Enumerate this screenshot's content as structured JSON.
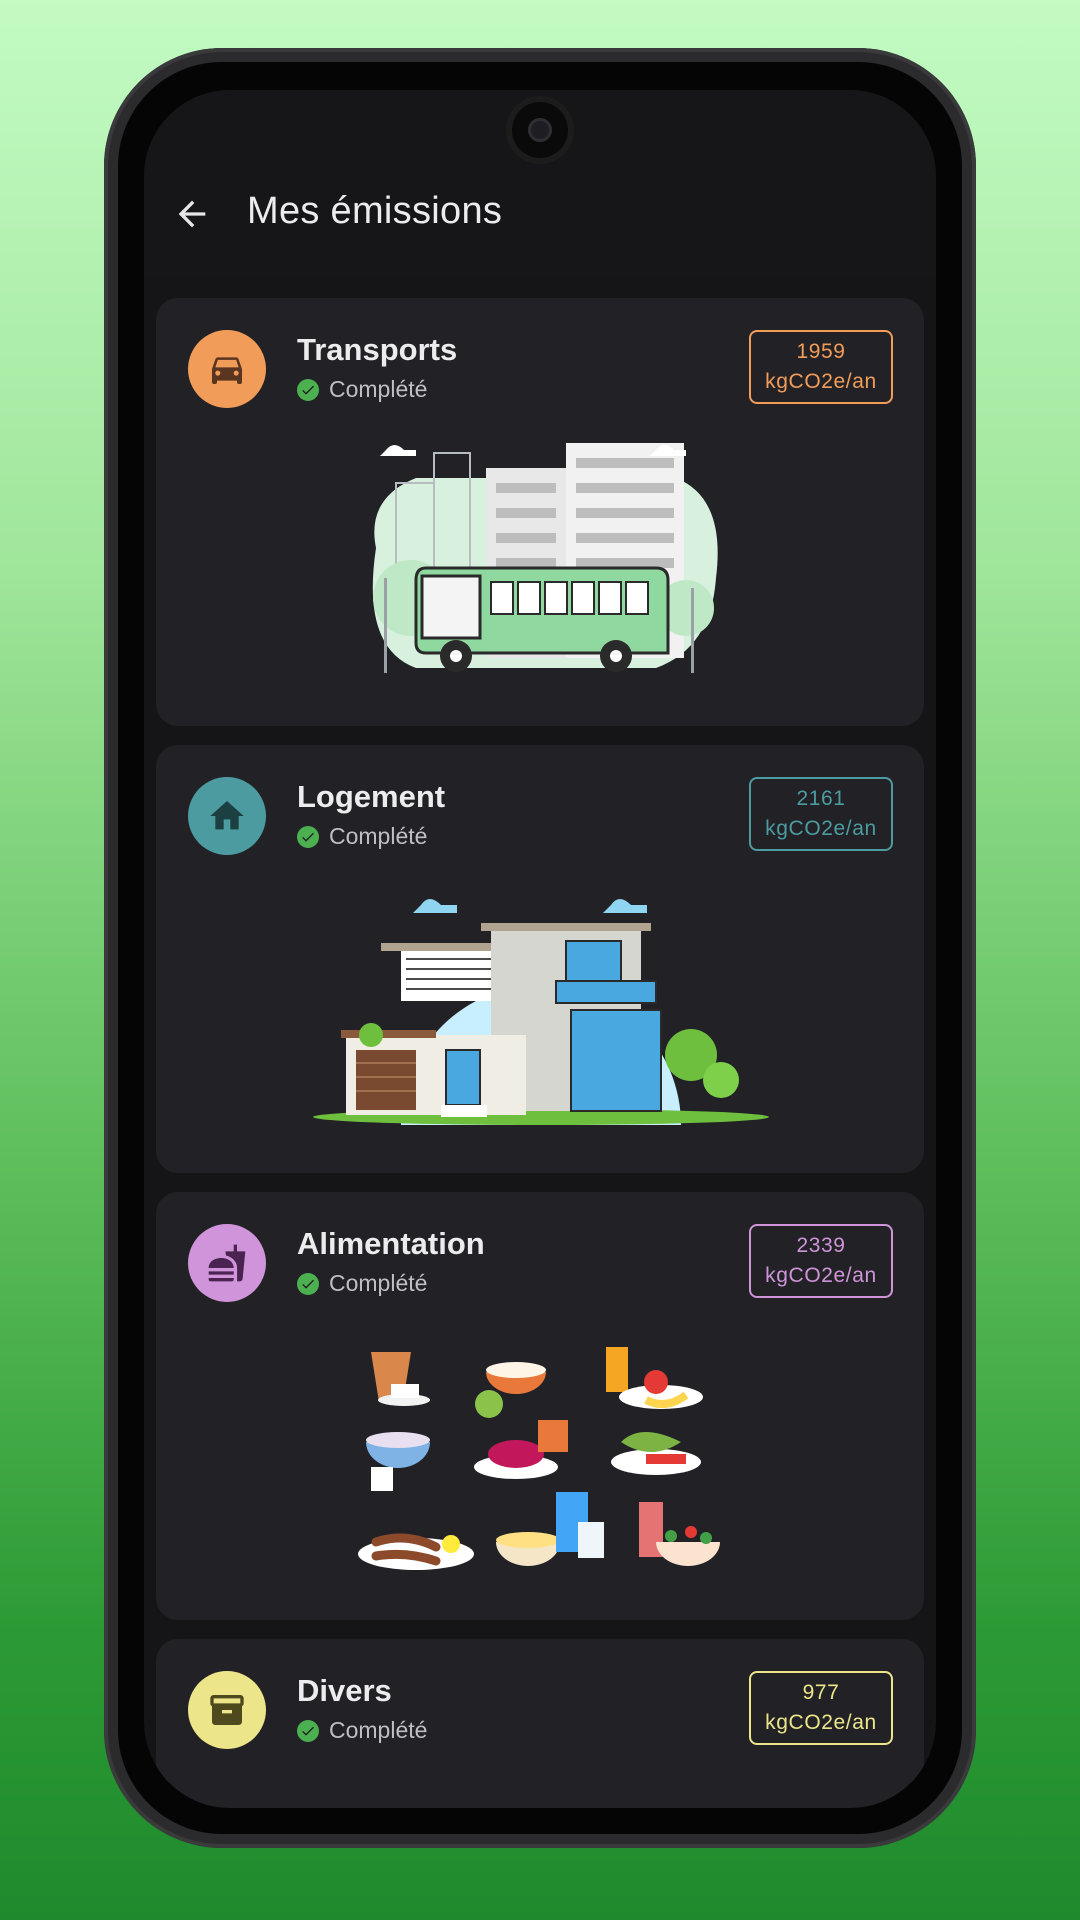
{
  "header": {
    "title": "Mes émissions",
    "back_icon": "arrow-back-icon"
  },
  "status_label": "Complété",
  "colors": {
    "transports": "#f29c5a",
    "logement": "#4c9ba0",
    "alimentation": "#cf94d9",
    "divers": "#ece58a"
  },
  "cards": [
    {
      "title": "Transports",
      "status": "Complété",
      "value": "1959",
      "unit": "kgCO2e/an",
      "icon": "car-icon",
      "illustration": "city-bus-illustration"
    },
    {
      "title": "Logement",
      "status": "Complété",
      "value": "2161",
      "unit": "kgCO2e/an",
      "icon": "home-icon",
      "illustration": "house-illustration"
    },
    {
      "title": "Alimentation",
      "status": "Complété",
      "value": "2339",
      "unit": "kgCO2e/an",
      "icon": "fastfood-icon",
      "illustration": "food-illustration"
    },
    {
      "title": "Divers",
      "status": "Complété",
      "value": "977",
      "unit": "kgCO2e/an",
      "icon": "box-icon",
      "illustration": ""
    }
  ]
}
